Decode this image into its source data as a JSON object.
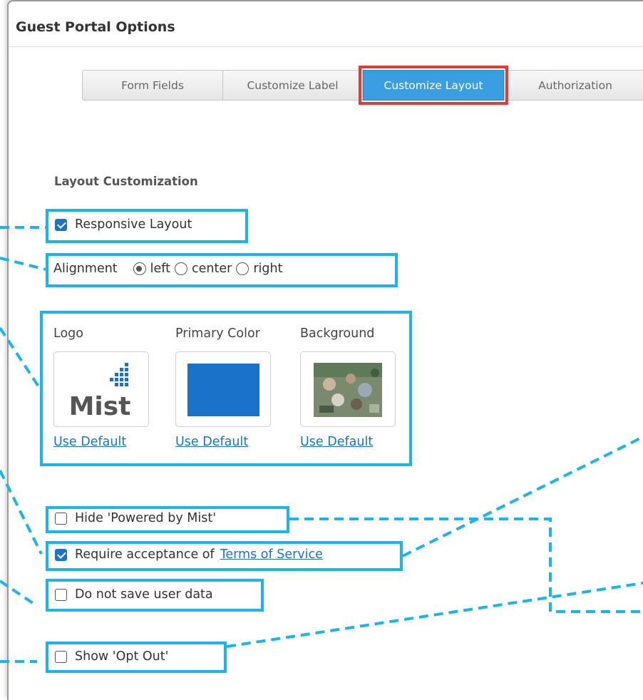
{
  "panel": {
    "title": "Guest Portal Options"
  },
  "tabs": [
    {
      "label": "Form Fields"
    },
    {
      "label": "Customize Label"
    },
    {
      "label": "Customize Layout",
      "active": true
    },
    {
      "label": "Authorization"
    }
  ],
  "layout": {
    "section_title": "Layout Customization",
    "responsive_layout": {
      "label": "Responsive Layout",
      "checked": true
    },
    "alignment": {
      "label": "Alignment",
      "options": [
        "left",
        "center",
        "right"
      ],
      "selected": "left"
    },
    "logo": {
      "label": "Logo",
      "logo_text": "Mist",
      "use_default": "Use Default"
    },
    "primary_color": {
      "label": "Primary Color",
      "value": "#1a73c9",
      "use_default": "Use Default"
    },
    "background": {
      "label": "Background",
      "use_default": "Use Default"
    }
  },
  "options": {
    "hide_powered_by": {
      "label": "Hide 'Powered by Mist'",
      "checked": false
    },
    "require_acceptance": {
      "label": "Require acceptance of",
      "link": "Terms of Service",
      "checked": true
    },
    "do_not_save": {
      "label": "Do not save user data",
      "checked": false
    },
    "show_opt_out": {
      "label": "Show 'Opt Out'",
      "checked": false
    }
  },
  "colors": {
    "accent": "#1ab4ef",
    "active_tab": "#3a9ee3",
    "highlight_red": "#e23b33",
    "link": "#1a73c9"
  }
}
